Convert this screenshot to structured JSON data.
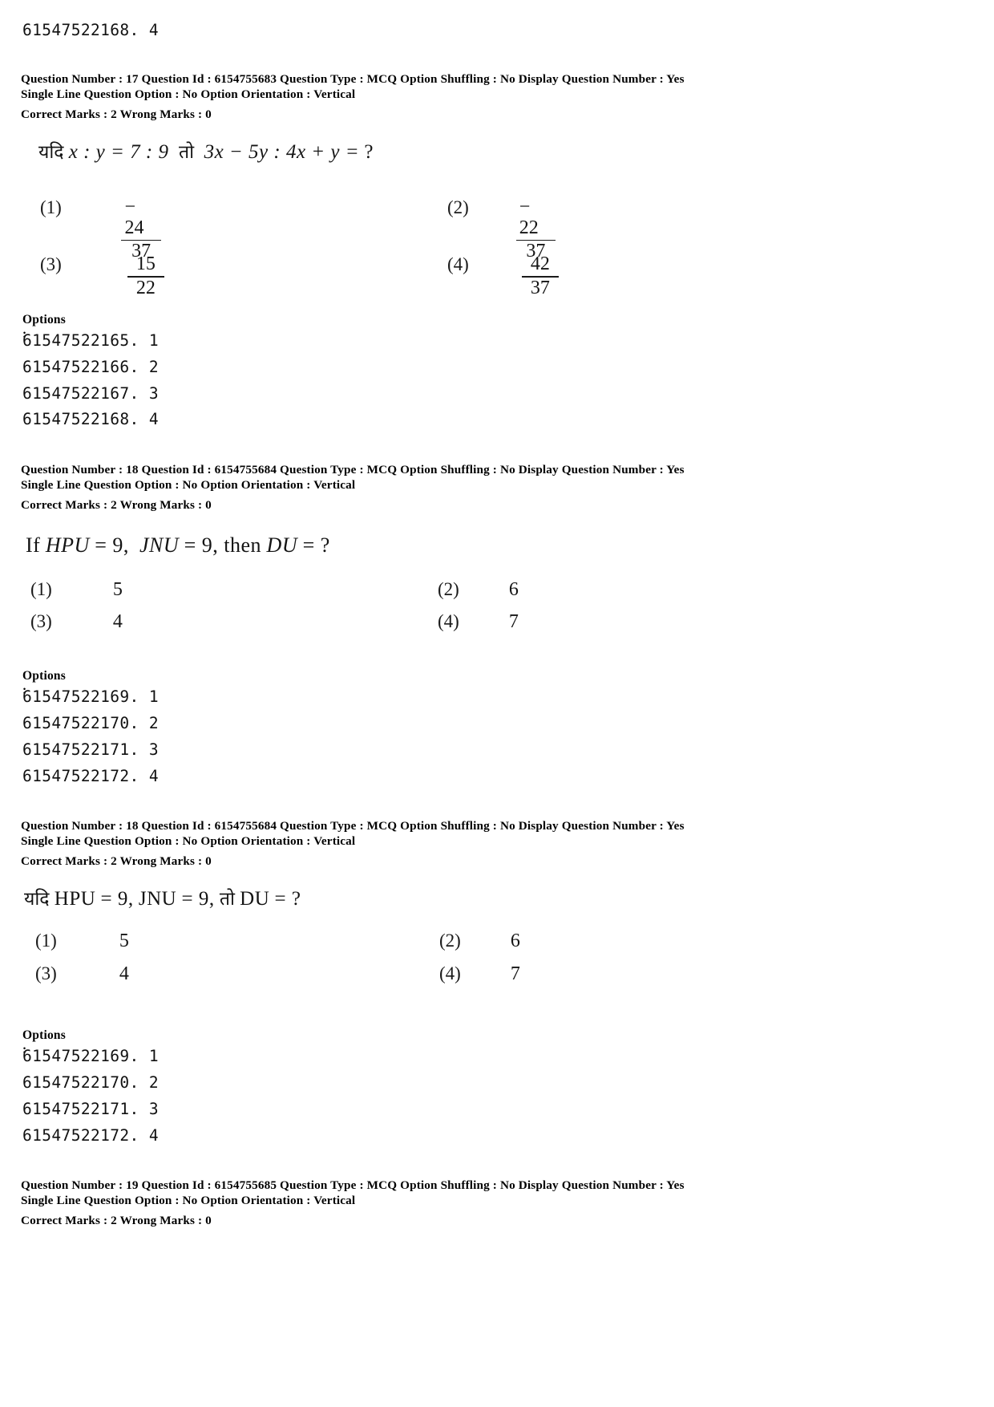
{
  "document": {
    "type": "exam-question-paper",
    "top_orphan_option_id": "61547522168. 4"
  },
  "questions": [
    {
      "meta_line1": "Question Number : 17  Question Id : 6154755683  Question Type : MCQ  Option Shuffling : No  Display Question Number : Yes",
      "meta_line2": "Single Line Question Option : No  Option Orientation : Vertical",
      "meta_marks": "Correct Marks : 2  Wrong Marks : 0",
      "stem_language": "hindi",
      "stem_parts": {
        "lead": "यदि",
        "expr1": "x : y = 7 : 9",
        "connector": "तो",
        "expr2": "3x − 5y : 4x + y =",
        "qmark": "?"
      },
      "option_type": "fraction",
      "options": [
        {
          "label": "(1)",
          "num": "− 24",
          "den": "37"
        },
        {
          "label": "(2)",
          "num": "− 22",
          "den": "37"
        },
        {
          "label": "(3)",
          "num": "15",
          "den": "22"
        },
        {
          "label": "(4)",
          "num": "42",
          "den": "37"
        }
      ],
      "options_caption": "Options :",
      "option_ids": [
        "61547522165. 1",
        "61547522166. 2",
        "61547522167. 3",
        "61547522168. 4"
      ]
    },
    {
      "meta_line1": "Question Number : 18  Question Id : 6154755684  Question Type : MCQ  Option Shuffling : No  Display Question Number : Yes",
      "meta_line2": "Single Line Question Option : No  Option Orientation : Vertical",
      "meta_marks": "Correct Marks : 2  Wrong Marks : 0",
      "stem_language": "english",
      "stem_parts": {
        "lead": "If",
        "expr1": "HPU",
        "eq1": "= 9,",
        "expr2": "JNU",
        "eq2": "= 9, then",
        "expr3": "DU",
        "eq3": "= ?"
      },
      "option_type": "plain",
      "options": [
        {
          "label": "(1)",
          "value": "5"
        },
        {
          "label": "(2)",
          "value": "6"
        },
        {
          "label": "(3)",
          "value": "4"
        },
        {
          "label": "(4)",
          "value": "7"
        }
      ],
      "options_caption": "Options :",
      "option_ids": [
        "61547522169. 1",
        "61547522170. 2",
        "61547522171. 3",
        "61547522172. 4"
      ]
    },
    {
      "meta_line1": "Question Number : 18  Question Id : 6154755684  Question Type : MCQ  Option Shuffling : No  Display Question Number : Yes",
      "meta_line2": "Single Line Question Option : No  Option Orientation : Vertical",
      "meta_marks": "Correct Marks : 2  Wrong Marks : 0",
      "stem_language": "hindi",
      "stem_parts": {
        "lead": "यदि",
        "expr1": "HPU",
        "eq1": "= 9,",
        "expr2": "JNU",
        "eq2": "= 9,",
        "connector": "तो",
        "expr3": "DU",
        "eq3": "= ?"
      },
      "option_type": "plain",
      "options": [
        {
          "label": "(1)",
          "value": "5"
        },
        {
          "label": "(2)",
          "value": "6"
        },
        {
          "label": "(3)",
          "value": "4"
        },
        {
          "label": "(4)",
          "value": "7"
        }
      ],
      "options_caption": "Options :",
      "option_ids": [
        "61547522169. 1",
        "61547522170. 2",
        "61547522171. 3",
        "61547522172. 4"
      ]
    },
    {
      "meta_line1": "Question Number : 19  Question Id : 6154755685  Question Type : MCQ  Option Shuffling : No  Display Question Number : Yes",
      "meta_line2": "Single Line Question Option : No  Option Orientation : Vertical",
      "meta_marks": "Correct Marks : 2  Wrong Marks : 0"
    }
  ]
}
